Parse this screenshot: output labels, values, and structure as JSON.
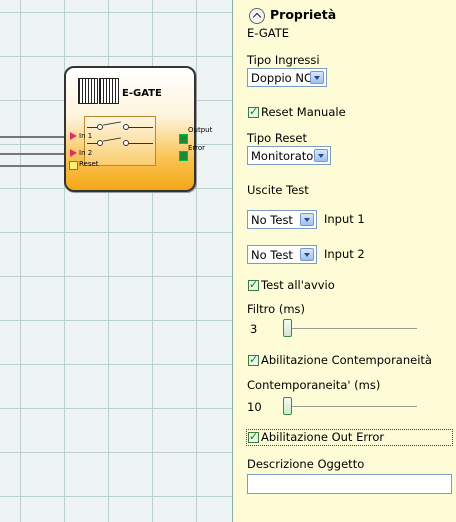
{
  "block": {
    "title": "E-GATE",
    "inputs": [
      "In 1",
      "In 2",
      "Reset"
    ],
    "outputs": [
      "Output",
      "Error"
    ]
  },
  "panel": {
    "header": "Proprietà",
    "object_name": "E-GATE",
    "tipo_ingressi_label": "Tipo Ingressi",
    "tipo_ingressi_value": "Doppio NC",
    "reset_manuale_label": "Reset Manuale",
    "tipo_reset_label": "Tipo Reset",
    "tipo_reset_value": "Monitorato",
    "uscite_test_label": "Uscite Test",
    "test_rows": [
      {
        "value": "No Test",
        "label": "Input 1"
      },
      {
        "value": "No Test",
        "label": "Input 2"
      }
    ],
    "test_avvio_label": "Test all'avvio",
    "filtro_label": "Filtro (ms)",
    "filtro_value": "3",
    "abilitazione_contemp_label": "Abilitazione Contemporaneità",
    "contemporaneita_label": "Contemporaneita' (ms)",
    "contemporaneita_value": "10",
    "abilitazione_out_error_label": "Abilitazione Out Error",
    "descrizione_label": "Descrizione Oggetto",
    "descrizione_value": ""
  },
  "colors": {
    "panel_bg": "#fdfcd6",
    "block_gradient_bottom": "#f4a718",
    "canvas_bg": "#eef3f3",
    "input_pin": "#e0306a",
    "output_pin": "#1a8a3a"
  }
}
